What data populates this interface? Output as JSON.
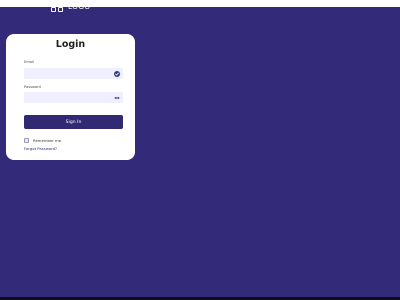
{
  "logo": {
    "text": "LOGO"
  },
  "login": {
    "title": "Login",
    "email": {
      "label": "Email",
      "value": "",
      "icon": "check-circle-icon"
    },
    "password": {
      "label": "Password",
      "value": "",
      "icon": "eye-icon"
    },
    "signin_label": "Sign In",
    "remember_label": "Remember me",
    "remember_checked": false,
    "forgot_label": "Forgot Password?"
  },
  "colors": {
    "background": "#332a7a",
    "button": "#312a72",
    "field": "#efefff",
    "card": "#ffffff"
  }
}
